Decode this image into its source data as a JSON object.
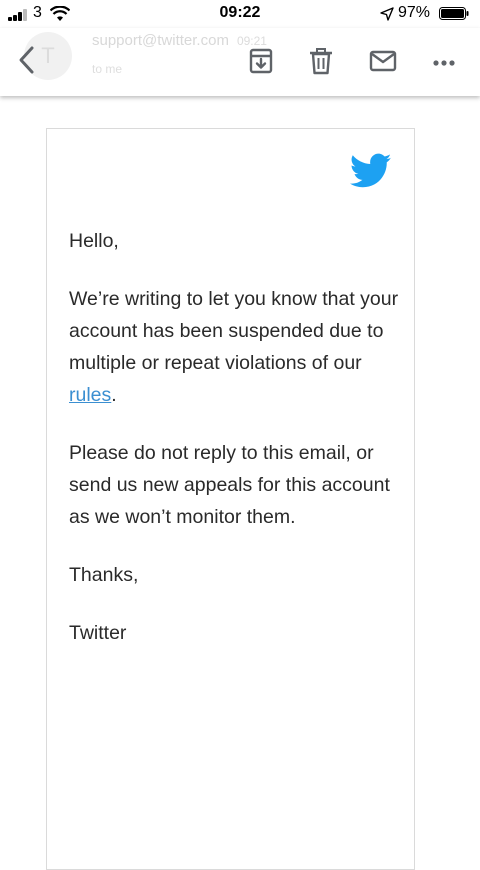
{
  "status_bar": {
    "carrier": "3",
    "time": "09:22",
    "battery": "97%"
  },
  "header": {
    "avatar_letter": "T",
    "sender": "support@twitter.com",
    "time": "09:21",
    "to_line": "to me"
  },
  "email": {
    "greeting": "Hello,",
    "para1_start": "We’re writing to let you know that your account has been suspended due to multiple or repeat violations of our ",
    "link_text": "rules",
    "para1_end": ".",
    "para2": "Please do not reply to this email, or send us new appeals for this account as we won’t monitor them.",
    "closing": "Thanks,",
    "signature": "Twitter"
  },
  "colors": {
    "twitter_blue": "#1DA1F2",
    "link": "#3b8fd1"
  }
}
